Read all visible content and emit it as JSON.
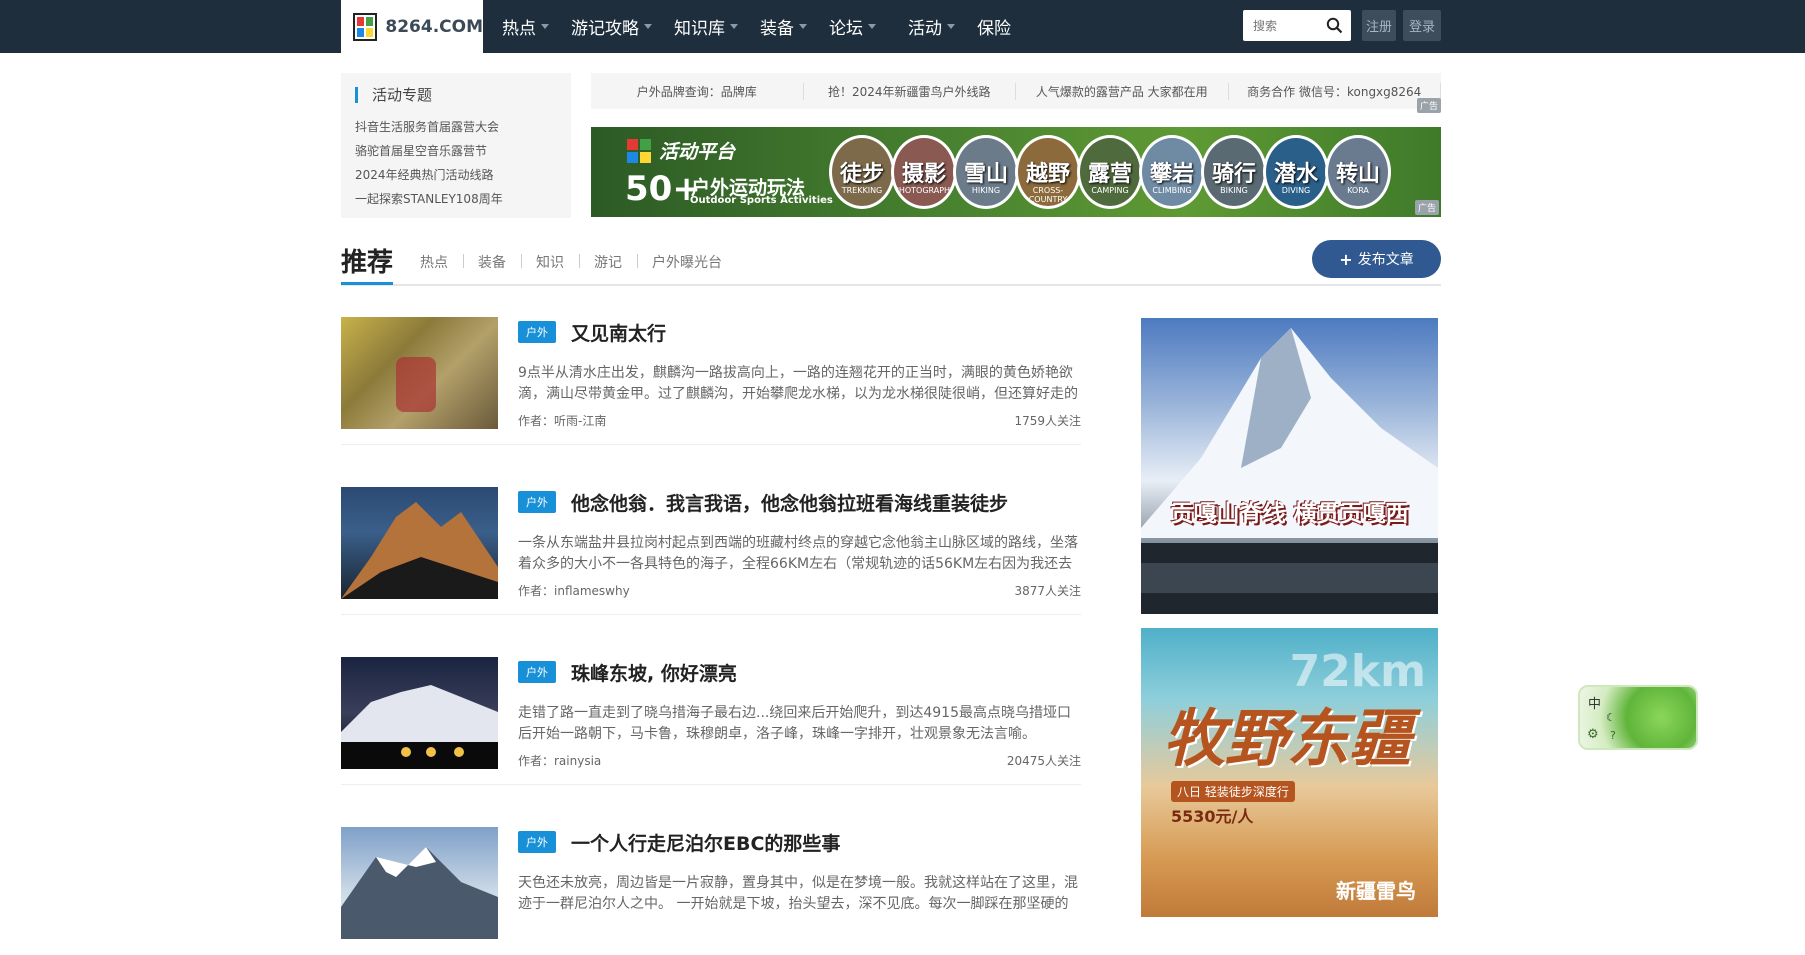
{
  "header": {
    "logo_text": "8264.COM",
    "nav": [
      "热点",
      "游记攻略",
      "知识库",
      "装备",
      "论坛",
      "活动",
      "保险"
    ],
    "search_placeholder": "搜索",
    "register": "注册",
    "login": "登录"
  },
  "activity": {
    "title": "活动专题",
    "items": [
      "抖音生活服务首届露营大会",
      "骆驼首届星空音乐露营节",
      "2024年经典热门活动线路",
      "一起探索STANLEY108周年"
    ]
  },
  "ad_links": [
    "户外品牌查询：品牌库",
    "抢！2024年新疆雷鸟户外线路",
    "人气爆款的露营产品 大家都在用",
    "商务合作 微信号：kongxg8264"
  ],
  "ad_tag": "广告",
  "banner": {
    "title": "活动平台",
    "big": "50+",
    "cn": "户外运动玩法",
    "en": "Outdoor Sports Activities",
    "circles": [
      {
        "cn": "徒步",
        "en": "TREKKING"
      },
      {
        "cn": "摄影",
        "en": "PHOTOGRAPHY"
      },
      {
        "cn": "雪山",
        "en": "HIKING"
      },
      {
        "cn": "越野",
        "en": "CROSS-COUNTRY"
      },
      {
        "cn": "露营",
        "en": "CAMPING"
      },
      {
        "cn": "攀岩",
        "en": "CLIMBING"
      },
      {
        "cn": "骑行",
        "en": "BIKING"
      },
      {
        "cn": "潜水",
        "en": "DIVING"
      },
      {
        "cn": "转山",
        "en": "KORA"
      }
    ]
  },
  "tabs": {
    "main": "推荐",
    "subs": [
      "热点",
      "装备",
      "知识",
      "游记",
      "户外曝光台"
    ],
    "publish": "发布文章"
  },
  "articles": [
    {
      "badge": "户外",
      "title": "又见南太行",
      "desc": "9点半从清水庄出发，麒麟沟一路拔高向上，一路的连翘花开的正当时，满眼的黄色娇艳欲滴，满山尽带黄金甲。过了麒麟沟，开始攀爬龙水梯，以为龙水梯很陡很峭，但还算好走的",
      "author": "作者：听雨-江南",
      "follow": "1759人关注"
    },
    {
      "badge": "户外",
      "title": "他念他翁．我言我语，他念他翁拉班看海线重装徒步",
      "desc": "一条从东端盐井县拉岗村起点到西端的班藏村终点的穿越它念他翁主山脉区域的路线，坐落着众多的大小不一各具特色的海子，全程66KM左右（常规轨迹的话56KM左右因为我还去",
      "author": "作者：inflameswhy",
      "follow": "3877人关注"
    },
    {
      "badge": "户外",
      "title": "珠峰东坡, 你好漂亮",
      "desc": "走错了路一直走到了晓乌措海子最右边...绕回来后开始爬升，到达4915最高点晓乌措垭口后开始一路朝下，马卡鲁，珠穆朗卓，洛子峰，珠峰一字排开，壮观景象无法言喻。",
      "author": "作者：rainysia",
      "follow": "20475人关注"
    },
    {
      "badge": "户外",
      "title": "一个人行走尼泊尔EBC的那些事",
      "desc": "天色还未放亮，周边皆是一片寂静，置身其中，似是在梦境一般。我就这样站在了这里，混迹于一群尼泊尔人之中。 一开始就是下坡，抬头望去，深不见底。每次一脚踩在那坚硬的",
      "author": "",
      "follow": ""
    }
  ],
  "right_ads": [
    {
      "text": "贡嘎山脊线 横贯贡嘎西"
    },
    {
      "text": "牧野东疆",
      "sub": "72km",
      "tag": "八日 轻装徒步深度行",
      "price": "5530元/人",
      "brand": "新疆雷鸟"
    }
  ],
  "float_widget": {
    "label": "中"
  }
}
